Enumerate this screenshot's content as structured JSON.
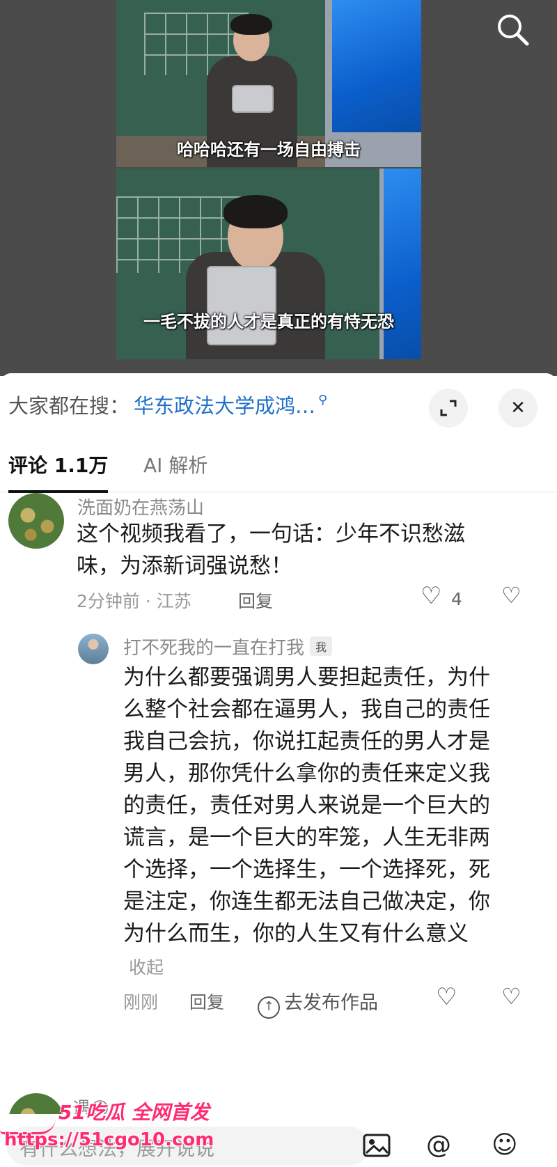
{
  "video": {
    "subtitle_top": "哈哈哈还有一场自由搏击",
    "subtitle_bottom": "一毛不拔的人才是真正的有恃无恐"
  },
  "search_bar": {
    "prefix": "大家都在搜：",
    "query": "华东政法大学成鸿…",
    "icon": "search-icon"
  },
  "tabs": [
    {
      "label": "评论 1.1万",
      "active": true
    },
    {
      "label": "AI 解析",
      "active": false
    }
  ],
  "comments": [
    {
      "username": "洗面奶在燕荡山",
      "text_line1": "这个视频我看了，一句话：少年不识愁滋",
      "text_line2": "味，为添新词强说愁！",
      "meta": "2分钟前 · 江苏",
      "reply_label": "回复",
      "like_count": "4"
    }
  ],
  "reply": {
    "username": "打不死我的一直在打我",
    "badge": "我",
    "lines": [
      "为什么都要强调男人要担起责任，为什",
      "么整个社会都在逼男人，我自己的责任",
      "我自己会抗，你说扛起责任的男人才是",
      "男人，那你凭什么拿你的责任来定义我",
      "的责任，责任对男人来说是一个巨大的",
      "谎言，是一个巨大的牢笼，人生无非两",
      "个选择，一个选择生，一个选择死，死",
      "是注定，你连生都无法自己做决定，你",
      "为什么而生，你的人生又有什么意义"
    ],
    "collapse_label": "收起",
    "time": "刚刚",
    "reply_label": "回复",
    "publish_label": "去发布作品"
  },
  "next_comment": {
    "username_fragment": "遇😚"
  },
  "input_bar": {
    "placeholder": "有什么想法，展开说说"
  },
  "watermark": {
    "title": "51吃瓜 全网首发",
    "url": "https://51cgo10.com"
  },
  "colors": {
    "link_blue": "#1e6fc9",
    "watermark_pink": "#ff2a73"
  }
}
